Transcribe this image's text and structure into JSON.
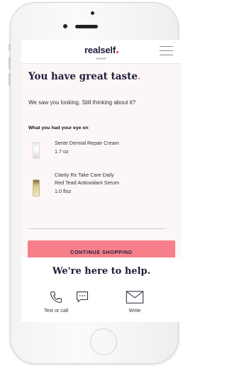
{
  "brand": {
    "name": "realself",
    "sub": "SHOP",
    "accent": "#f6808a",
    "text_color": "#1e1b3a"
  },
  "header": {
    "menu_icon": "hamburger-menu-icon"
  },
  "main": {
    "title": "You have great taste",
    "title_dot": ".",
    "subtitle": "We saw you looking. Still thinking about it?",
    "section_label": "What you had your eye on",
    "products": [
      {
        "name": "Sente Dermal Repair Cream",
        "size": "1.7 oz"
      },
      {
        "name_line1": "Clarity Rx Take Care Daily",
        "name_line2": "Red Tead Antioxidant Serum",
        "size": "1.0 floz"
      }
    ],
    "cta_label": "CONTINUE SHOPPING"
  },
  "help": {
    "title": "We're here to help.",
    "items": [
      {
        "label": "Text or call",
        "icon": "phone-icon"
      },
      {
        "label": "",
        "icon": "chat-bubble-icon"
      },
      {
        "label": "Write",
        "icon": "envelope-icon"
      }
    ]
  }
}
